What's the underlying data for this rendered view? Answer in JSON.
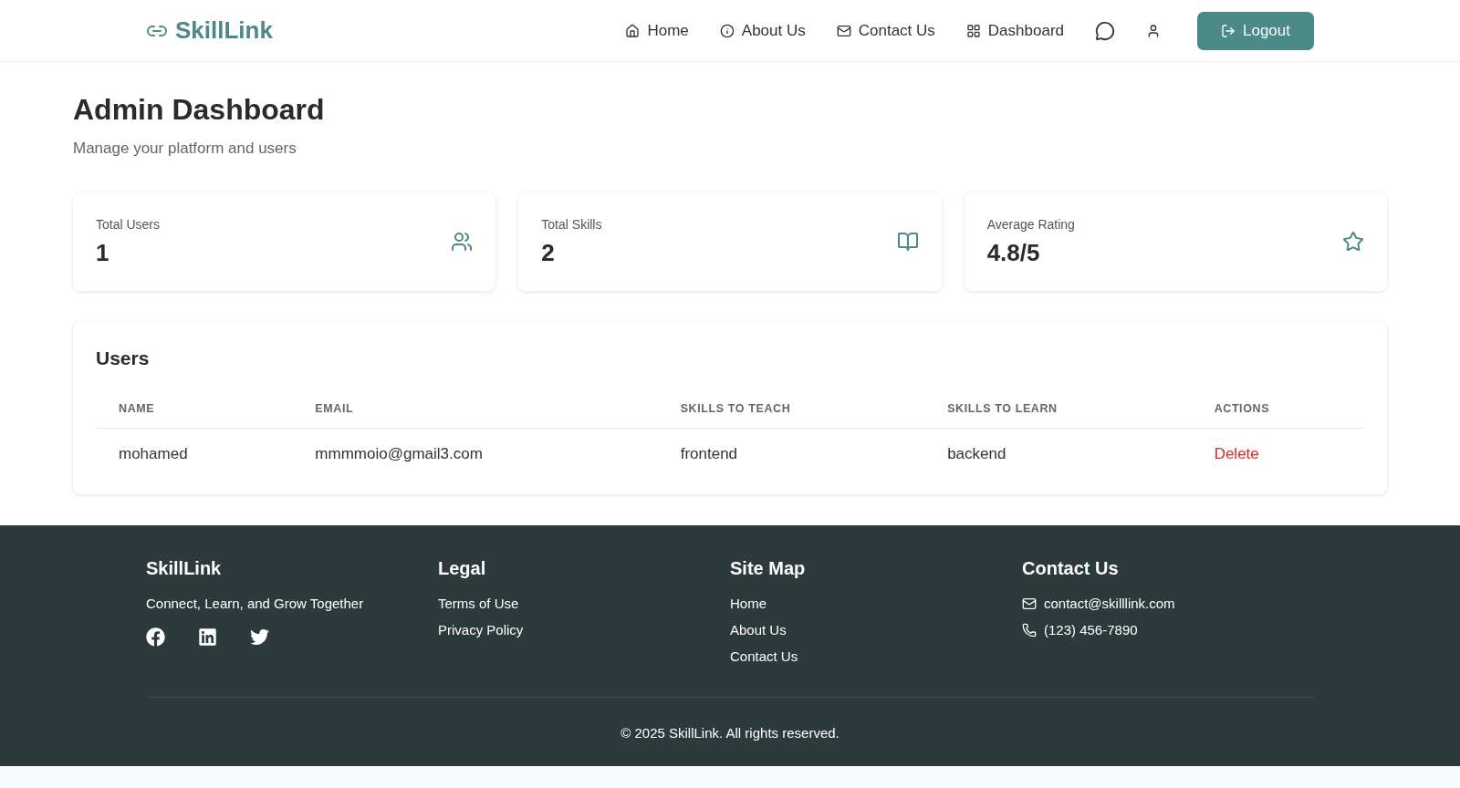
{
  "brand": {
    "name": "SkillLink"
  },
  "nav": [
    {
      "kind": "home",
      "label": "Home"
    },
    {
      "kind": "info",
      "label": "About Us"
    },
    {
      "kind": "mail",
      "label": "Contact Us"
    },
    {
      "kind": "grid",
      "label": "Dashboard"
    }
  ],
  "logout": {
    "label": "Logout"
  },
  "page": {
    "title": "Admin Dashboard",
    "subtitle": "Manage your platform and users"
  },
  "stats": [
    {
      "kind": "users",
      "label": "Total Users",
      "value": "1"
    },
    {
      "kind": "book",
      "label": "Total Skills",
      "value": "2"
    },
    {
      "kind": "star",
      "label": "Average Rating",
      "value": "4.8/5"
    }
  ],
  "users_table": {
    "title": "Users",
    "columns": [
      "NAME",
      "EMAIL",
      "SKILLS TO TEACH",
      "SKILLS TO LEARN",
      "ACTIONS"
    ],
    "rows": [
      {
        "name": "mohamed",
        "email": "mmmmoio@gmail3.com",
        "teach": "frontend",
        "learn": "backend",
        "action": "Delete"
      }
    ]
  },
  "footer": {
    "brand": "SkillLink",
    "tagline": "Connect, Learn, and Grow Together",
    "social": [
      {
        "kind": "facebook"
      },
      {
        "kind": "linkedin"
      },
      {
        "kind": "twitter"
      }
    ],
    "legal": {
      "title": "Legal",
      "links": [
        "Terms of Use",
        "Privacy Policy"
      ]
    },
    "sitemap": {
      "title": "Site Map",
      "links": [
        "Home",
        "About Us",
        "Contact Us"
      ]
    },
    "contact": {
      "title": "Contact Us",
      "items": [
        {
          "kind": "mail",
          "text": "contact@skilllink.com"
        },
        {
          "kind": "phone",
          "text": "(123) 456-7890"
        }
      ]
    },
    "copyright": "© 2025 SkillLink. All rights reserved."
  }
}
